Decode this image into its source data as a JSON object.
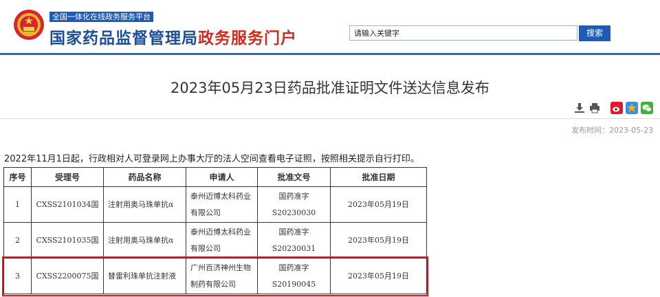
{
  "header": {
    "slogan": "全国一体化在线政务服务平台",
    "brand_main": "国家药品监督管理局",
    "brand_sub": "政务服务门户",
    "search_placeholder": "请输入关键字",
    "search_button": "搜索"
  },
  "article": {
    "title": "2023年05月23日药品批准证明文件送达信息发布",
    "publish_label": "发布时间：",
    "publish_date": "2023-05-23",
    "notice": "2022年11月1日起，行政相对人可登录网上办事大厅的法人空间查看电子证照，按照相关提示自行打印。"
  },
  "tools": {
    "icons": [
      "download-icon",
      "print-icon",
      "weibo-icon",
      "qzone-icon",
      "wechat-icon"
    ],
    "colors": {
      "weibo": "#e6162d",
      "qzone": "#f5b400",
      "wechat": "#3fb13f"
    }
  },
  "table": {
    "headers": [
      "序号",
      "受理号",
      "药品名称",
      "申请人",
      "批准文号",
      "批准日期"
    ],
    "rows": [
      {
        "no": "1",
        "accept_no": "CXSS2101034国",
        "drug_name": "注射用奥马珠单抗α",
        "applicant": "泰州迈博太科药业有限公司",
        "approval_no": "国药准字S20230030",
        "date": "2023年05月19日"
      },
      {
        "no": "2",
        "accept_no": "CXSS2101035国",
        "drug_name": "注射用奥马珠单抗α",
        "applicant": "泰州迈博太科药业有限公司",
        "approval_no": "国药准字S20230031",
        "date": "2023年05月19日"
      },
      {
        "no": "3",
        "accept_no": "CXSS2200075国",
        "drug_name": "替雷利珠单抗注射液",
        "applicant": "广州百济神州生物制药有限公司",
        "approval_no": "国药准字S20190045",
        "date": "2023年05月19日"
      }
    ]
  },
  "highlight_color": "#e0151f"
}
